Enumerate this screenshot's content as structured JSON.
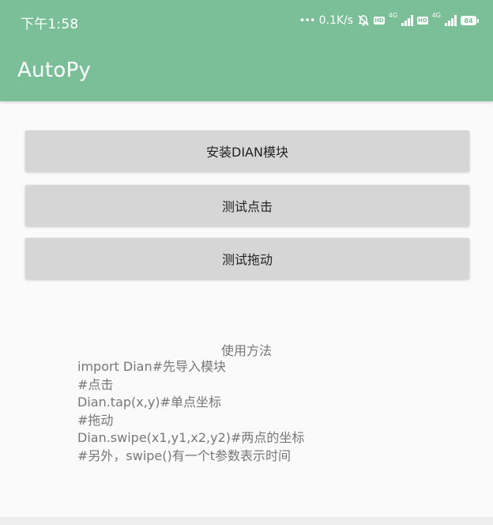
{
  "status_bar": {
    "time": "下午1:58",
    "dots": "•••",
    "net_speed": "0.1K/s",
    "hd_label": "HD",
    "network_type": "4G",
    "battery_level": "84"
  },
  "app_bar": {
    "title": "AutoPy",
    "color": "#7abf98"
  },
  "buttons": [
    {
      "label": "安装DIAN模块"
    },
    {
      "label": "测试点击"
    },
    {
      "label": "测试拖动"
    }
  ],
  "usage": {
    "title": "使用方法",
    "lines": [
      "import Dian#先导入模块",
      "#点击",
      "Dian.tap(x,y)#单点坐标",
      "#拖动",
      "Dian.swipe(x1,y1,x2,y2)#两点的坐标",
      "#另外，swipe()有一个t参数表示时间"
    ]
  }
}
